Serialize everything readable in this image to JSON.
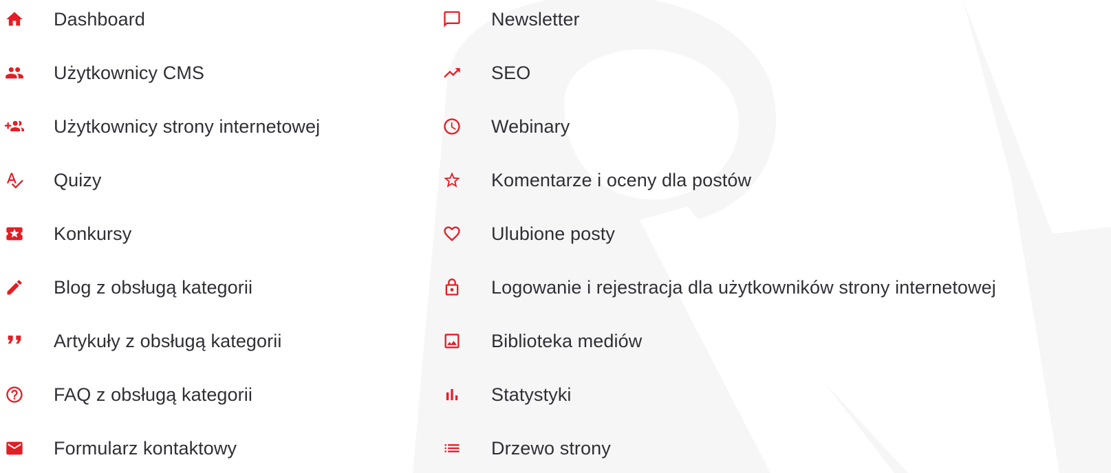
{
  "accent": "#e31e24",
  "left_items": [
    {
      "label": "Dashboard",
      "icon": "home-icon"
    },
    {
      "label": "Użytkownicy CMS",
      "icon": "people-icon"
    },
    {
      "label": "Użytkownicy strony internetowej",
      "icon": "add-group-icon"
    },
    {
      "label": "Quizy",
      "icon": "spellcheck-icon"
    },
    {
      "label": "Konkursy",
      "icon": "ticket-star-icon"
    },
    {
      "label": "Blog z obsługą kategorii",
      "icon": "pencil-icon"
    },
    {
      "label": "Artykuły z obsługą kategorii",
      "icon": "quote-icon"
    },
    {
      "label": "FAQ z obsługą kategorii",
      "icon": "help-circle-icon"
    },
    {
      "label": "Formularz kontaktowy",
      "icon": "mail-icon"
    }
  ],
  "right_items": [
    {
      "label": "Newsletter",
      "icon": "chat-bubble-icon"
    },
    {
      "label": "SEO",
      "icon": "trending-up-icon"
    },
    {
      "label": "Webinary",
      "icon": "clock-icon"
    },
    {
      "label": "Komentarze i oceny dla postów",
      "icon": "star-outline-icon"
    },
    {
      "label": "Ulubione posty",
      "icon": "heart-outline-icon"
    },
    {
      "label": "Logowanie i rejestracja dla użytkowników strony internetowej",
      "icon": "lock-open-icon"
    },
    {
      "label": "Biblioteka mediów",
      "icon": "image-icon"
    },
    {
      "label": "Statystyki",
      "icon": "bar-chart-icon"
    },
    {
      "label": "Drzewo strony",
      "icon": "list-icon"
    }
  ]
}
